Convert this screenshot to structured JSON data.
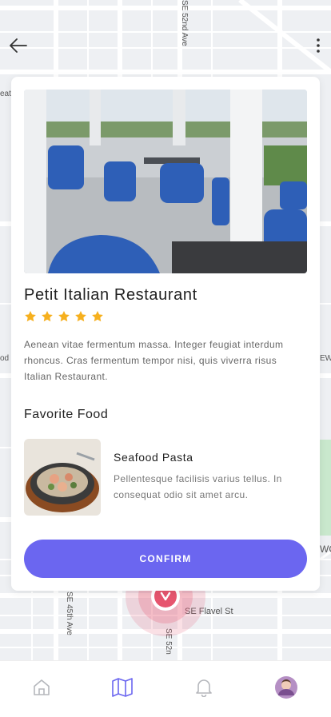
{
  "map": {
    "streets": [
      "SE 52nd Ave",
      "SE 45th Ave",
      "SE Flavel St",
      "SE 52n",
      "eat",
      "od",
      "EW",
      "WC"
    ]
  },
  "header": {
    "back_icon": "arrow-left-icon",
    "more_icon": "more-vertical-icon"
  },
  "restaurant": {
    "name": "Petit Italian Restaurant",
    "rating": 5,
    "rating_max": 5,
    "description": "Aenean vitae fermentum massa. Integer feugiat interdum rhoncus. Cras fermentum tempor nisi, quis viverra risus Italian Restaurant."
  },
  "favorites": {
    "heading": "Favorite Food",
    "item": {
      "name": "Seafood Pasta",
      "description": "Pellentesque facilisis varius tellus. In consequat odio sit amet arcu."
    }
  },
  "confirm_label": "CONFIRM",
  "nav": {
    "items": [
      {
        "icon": "home-icon",
        "active": false
      },
      {
        "icon": "map-icon",
        "active": true
      },
      {
        "icon": "bell-icon",
        "active": false
      },
      {
        "icon": "avatar",
        "active": false
      }
    ]
  },
  "colors": {
    "accent": "#6b66f0",
    "star": "#f6b01e",
    "marker": "#e6556e"
  }
}
